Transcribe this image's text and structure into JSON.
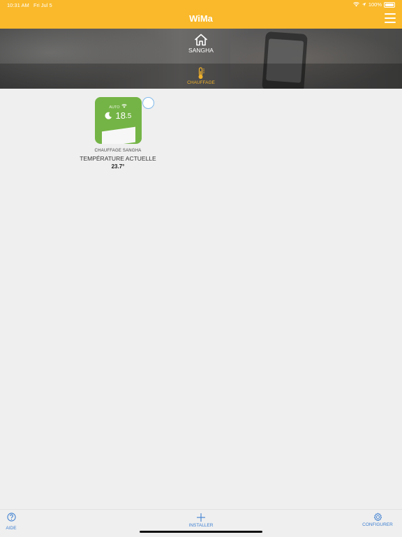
{
  "status": {
    "time": "10:31 AM",
    "date": "Fri Jul 5",
    "battery": "100%"
  },
  "header": {
    "title": "WiMa",
    "menu_icon": "hamburger-menu-icon"
  },
  "banner": {
    "home_label": "SANGHA",
    "home_icon": "home-icon",
    "category_label": "CHAUFFAGE",
    "category_icon": "thermometer-icon",
    "category_color": "#f2b22a"
  },
  "device": {
    "tile_color": "#74b446",
    "mode": "AUTO",
    "mode_icon": "moon-icon",
    "setpoint_int": "18",
    "setpoint_dec": ".5",
    "name": "CHAUFFAGE SANGHA",
    "label": "TEMPÉRATURE ACTUELLE",
    "value": "23.7°"
  },
  "bottom": {
    "help_label": "AIDE",
    "install_label": "INSTALLER",
    "configure_label": "CONFIGURER",
    "accent": "#3d7fd1"
  }
}
